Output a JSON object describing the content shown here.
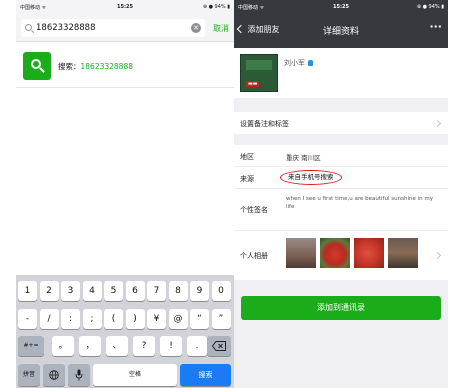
{
  "left_phone": {
    "status": {
      "carrier": "中国移动 ᯤ",
      "time": "15:25",
      "battery": "⊕ ● 94% ▮"
    },
    "search": {
      "query": "18623328888",
      "cancel_label": "取消"
    },
    "result": {
      "prefix": "搜索：",
      "number": "18623328888"
    },
    "keyboard": {
      "row1": [
        "1",
        "2",
        "3",
        "4",
        "5",
        "6",
        "7",
        "8",
        "9",
        "0"
      ],
      "row2": [
        "-",
        "/",
        ":",
        ";",
        "(",
        ")",
        "¥",
        "@",
        "“",
        "”"
      ],
      "row3_left": "#+=",
      "row3": [
        "。",
        "，",
        "、",
        "?",
        "!",
        "."
      ],
      "row4_left": "拼音",
      "row4_space": "空格",
      "row4_search": "搜索"
    }
  },
  "right_phone": {
    "status": {
      "carrier": "中国移动 ᯤ",
      "time": "15:25",
      "battery": "⊕ ● 94% ▮"
    },
    "nav": {
      "back_label": "添加朋友",
      "title": "详细资料",
      "more": "···"
    },
    "profile": {
      "name": "刘小军"
    },
    "remark_label": "设置备注和标签",
    "region": {
      "label": "地区",
      "value": "重庆  南川区"
    },
    "source": {
      "label": "来源",
      "value": "来自手机号搜索"
    },
    "signature": {
      "label": "个性签名",
      "value": "when I see u first time,u are beautiful sunshine in my life"
    },
    "album_label": "个人相册",
    "add_button": "添加到通讯录",
    "colors": {
      "brand_green": "#1aad19",
      "nav_dark": "#363a3f",
      "highlight_red": "#d42020"
    }
  }
}
